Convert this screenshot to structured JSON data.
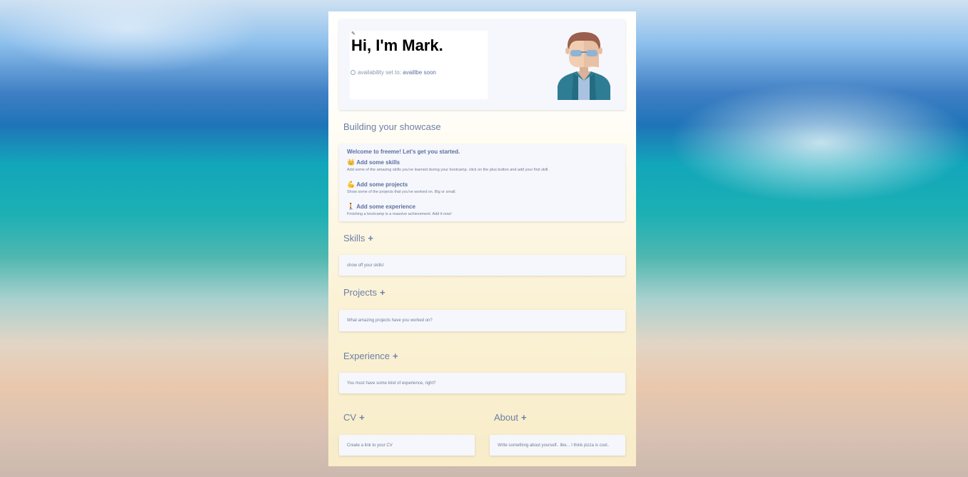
{
  "hero": {
    "edit_icon": "edit-icon",
    "title": "Hi, I'm Mark.",
    "availability_label": "availability set to:",
    "availability_value": "availlbe soon"
  },
  "showcase": {
    "title": "Building your showcase",
    "welcome": "Welcome to freeme! Let's get you started.",
    "steps": [
      {
        "emoji": "👑",
        "title": "Add some skills",
        "desc": "Add some of the amazing skills you've learned during your bootcamp. click on the plus button and add your first skill."
      },
      {
        "emoji": "💪",
        "title": "Add some projects",
        "desc": "Show some of the projects that you've worked on. Big or small."
      },
      {
        "emoji": "🚶",
        "title": "Add some experience",
        "desc": "Finishing a bootcamp is a massive achievement. Add it now!"
      }
    ]
  },
  "sections": {
    "skills": {
      "title": "Skills",
      "placeholder": "show off your skills!"
    },
    "projects": {
      "title": "Projects",
      "placeholder": "What amazing projects have you worked on?"
    },
    "experience": {
      "title": "Experience",
      "placeholder": "You must have some kind of experience, right?"
    },
    "cv": {
      "title": "CV",
      "placeholder": "Create a link to your CV"
    },
    "about": {
      "title": "About",
      "placeholder": "Write something about yourself.. like... I think pizza is cool.."
    }
  },
  "plus_symbol": "+"
}
